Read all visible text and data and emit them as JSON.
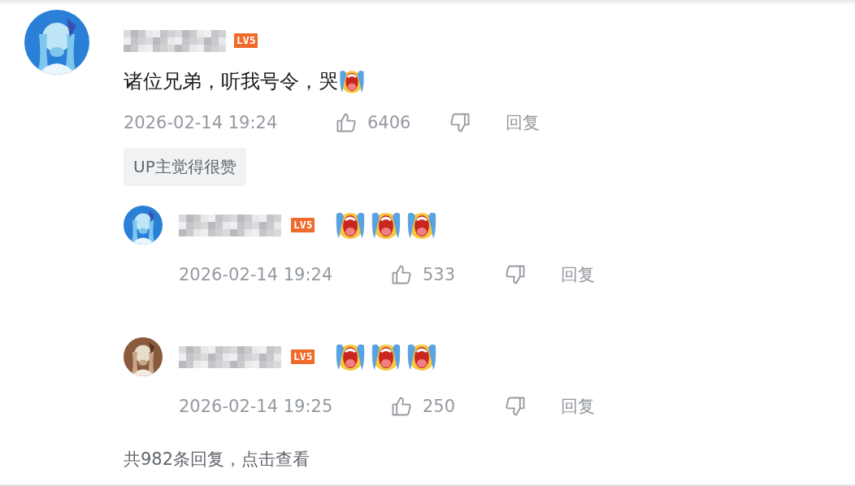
{
  "comment": {
    "user": {
      "level": "LV5"
    },
    "content": [
      {
        "kind": "text",
        "text": "诸位兄弟，听我号令，哭"
      },
      {
        "kind": "emoji"
      }
    ],
    "time": "2026-02-14 19:24",
    "likes": "6406",
    "reply_label": "回复",
    "tag": "UP主觉得很赞",
    "replies": [
      {
        "user": {
          "level": "LV5"
        },
        "content": [
          {
            "kind": "emoji"
          },
          {
            "kind": "emoji"
          },
          {
            "kind": "emoji"
          }
        ],
        "time": "2026-02-14 19:24",
        "likes": "533",
        "reply_label": "回复"
      },
      {
        "user": {
          "level": "LV5"
        },
        "content": [
          {
            "kind": "emoji"
          },
          {
            "kind": "emoji"
          },
          {
            "kind": "emoji"
          }
        ],
        "time": "2026-02-14 19:25",
        "likes": "250",
        "reply_label": "回复"
      }
    ],
    "more_replies": "共982条回复，点击查看"
  }
}
